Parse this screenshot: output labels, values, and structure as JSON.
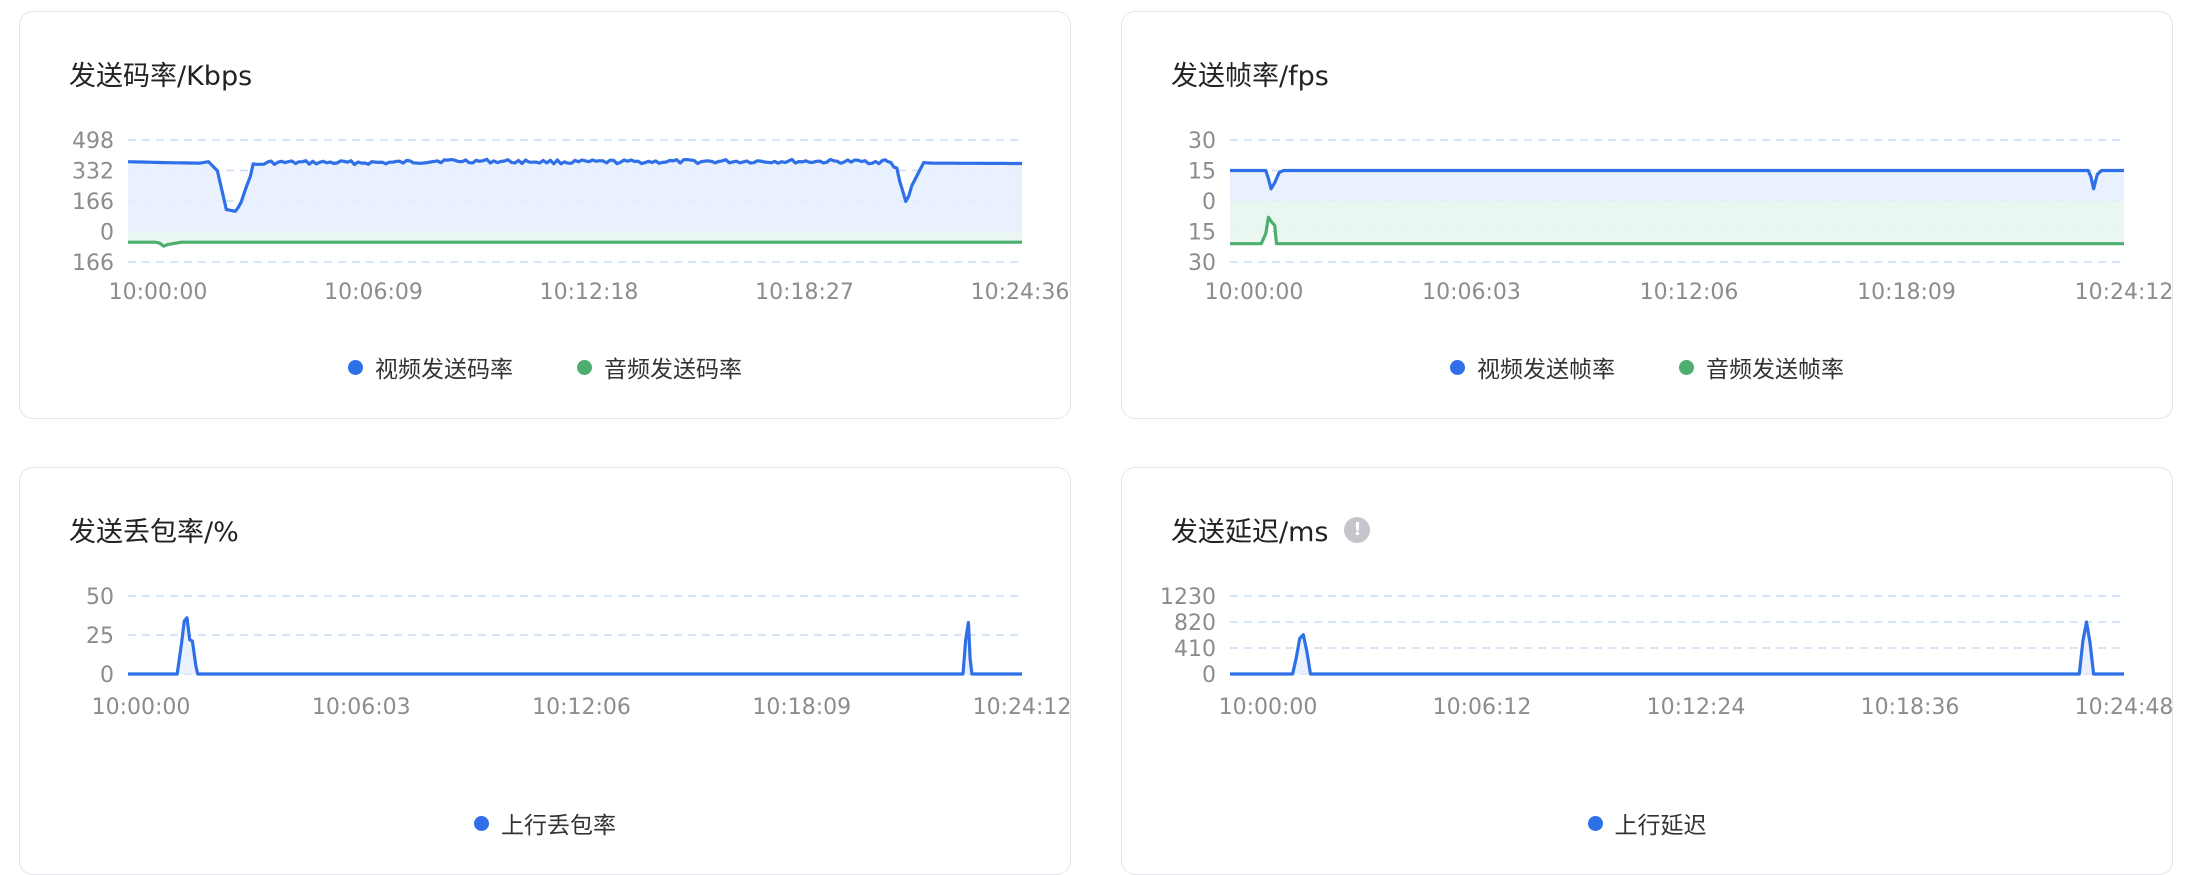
{
  "colors": {
    "video": "#2f6fe8",
    "audio": "#4caf6e",
    "grid": "#c9ddf3",
    "video_fill": "#e6f0fd",
    "audio_fill": "#e8f6ee"
  },
  "charts": [
    {
      "title": "发送码率/Kbps",
      "has_info_icon": false,
      "legend": [
        "视频发送码率",
        "音频发送码率"
      ],
      "chart_data": {
        "type": "line",
        "title": "发送码率/Kbps",
        "y_ticks": [
          "498",
          "332",
          "166",
          "0",
          "166"
        ],
        "x_ticks": [
          "10:00:00",
          "10:06:09",
          "10:12:18",
          "10:18:27",
          "10:24:36"
        ],
        "ylim": [
          -166,
          498
        ],
        "grid": true,
        "legend_position": "bottom",
        "series": [
          {
            "name": "视频发送码率",
            "color": "#2f6fe8",
            "mirrored": false,
            "points": [
              [
                0,
                380
              ],
              [
                4,
                375
              ],
              [
                8,
                372
              ],
              [
                9,
                380
              ],
              [
                10,
                330
              ],
              [
                11,
                120
              ],
              [
                12,
                110
              ],
              [
                13,
                200
              ],
              [
                14,
                360
              ],
              [
                16,
                375
              ],
              [
                30,
                375
              ],
              [
                35,
                385
              ],
              [
                50,
                378
              ],
              [
                70,
                382
              ],
              [
                84,
                380
              ],
              [
                85,
                383
              ],
              [
                86,
                340
              ],
              [
                87,
                160
              ],
              [
                88,
                280
              ],
              [
                89,
                375
              ],
              [
                90,
                372
              ],
              [
                100,
                370
              ]
            ],
            "jitter": 22,
            "jitter_start": 12,
            "jitter_end": 88
          },
          {
            "name": "音频发送码率",
            "color": "#4caf6e",
            "mirrored": true,
            "points": [
              [
                0,
                58
              ],
              [
                3,
                58
              ],
              [
                3.5,
                62
              ],
              [
                4,
                80
              ],
              [
                4.5,
                70
              ],
              [
                6,
                58
              ],
              [
                100,
                58
              ]
            ]
          }
        ]
      }
    },
    {
      "title": "发送帧率/fps",
      "has_info_icon": false,
      "legend": [
        "视频发送帧率",
        "音频发送帧率"
      ],
      "chart_data": {
        "type": "line",
        "title": "发送帧率/fps",
        "y_ticks": [
          "30",
          "15",
          "0",
          "15",
          "30"
        ],
        "x_ticks": [
          "10:00:00",
          "10:06:03",
          "10:12:06",
          "10:18:09",
          "10:24:12"
        ],
        "ylim": [
          -30,
          30
        ],
        "grid": true,
        "legend_position": "bottom",
        "series": [
          {
            "name": "视频发送帧率",
            "color": "#2f6fe8",
            "mirrored": false,
            "points": [
              [
                0,
                15
              ],
              [
                4,
                15
              ],
              [
                4.3,
                11
              ],
              [
                4.6,
                6
              ],
              [
                5,
                9
              ],
              [
                5.5,
                14
              ],
              [
                6,
                15
              ],
              [
                96,
                15
              ],
              [
                96.3,
                12
              ],
              [
                96.6,
                6
              ],
              [
                97,
                13
              ],
              [
                97.5,
                15
              ],
              [
                100,
                15
              ]
            ]
          },
          {
            "name": "音频发送帧率",
            "color": "#4caf6e",
            "mirrored": true,
            "points": [
              [
                0,
                21
              ],
              [
                3.5,
                21
              ],
              [
                4,
                16
              ],
              [
                4.3,
                8
              ],
              [
                4.6,
                10
              ],
              [
                5,
                12
              ],
              [
                5.2,
                21
              ],
              [
                100,
                21
              ]
            ]
          }
        ]
      }
    },
    {
      "title": "发送丢包率/%",
      "has_info_icon": false,
      "legend": [
        "上行丢包率"
      ],
      "chart_data": {
        "type": "line",
        "title": "发送丢包率/%",
        "y_ticks": [
          "50",
          "25",
          "0"
        ],
        "x_ticks": [
          "10:00:00",
          "10:06:03",
          "10:12:06",
          "10:18:09",
          "10:24:12"
        ],
        "ylim": [
          0,
          50
        ],
        "grid": true,
        "legend_position": "bottom",
        "series": [
          {
            "name": "上行丢包率",
            "color": "#2f6fe8",
            "mirrored": false,
            "points": [
              [
                0,
                0
              ],
              [
                5.5,
                0
              ],
              [
                6,
                20
              ],
              [
                6.3,
                34
              ],
              [
                6.6,
                36
              ],
              [
                6.9,
                22
              ],
              [
                7.2,
                21
              ],
              [
                7.6,
                5
              ],
              [
                7.8,
                0
              ],
              [
                93.4,
                0
              ],
              [
                93.7,
                22
              ],
              [
                94,
                33
              ],
              [
                94.2,
                10
              ],
              [
                94.4,
                0
              ],
              [
                100,
                0
              ]
            ]
          }
        ]
      }
    },
    {
      "title": "发送延迟/ms",
      "has_info_icon": true,
      "legend": [
        "上行延迟"
      ],
      "chart_data": {
        "type": "line",
        "title": "发送延迟/ms",
        "y_ticks": [
          "1230",
          "820",
          "410",
          "0"
        ],
        "x_ticks": [
          "10:00:00",
          "10:06:12",
          "10:12:24",
          "10:18:36",
          "10:24:48"
        ],
        "ylim": [
          0,
          1230
        ],
        "grid": true,
        "legend_position": "bottom",
        "series": [
          {
            "name": "上行延迟",
            "color": "#2f6fe8",
            "mirrored": false,
            "points": [
              [
                0,
                0
              ],
              [
                7,
                0
              ],
              [
                7.4,
                250
              ],
              [
                7.8,
                560
              ],
              [
                8.2,
                620
              ],
              [
                8.6,
                350
              ],
              [
                9,
                0
              ],
              [
                95,
                0
              ],
              [
                95.4,
                520
              ],
              [
                95.8,
                820
              ],
              [
                96.2,
                500
              ],
              [
                96.6,
                0
              ],
              [
                100,
                0
              ]
            ]
          }
        ]
      }
    }
  ]
}
